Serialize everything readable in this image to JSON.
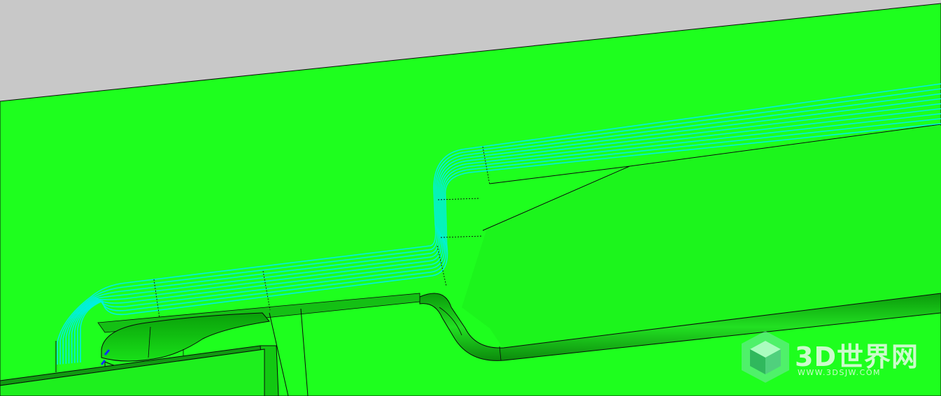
{
  "scene": {
    "background_color": "#c8c8c8",
    "part_face_color": "#1eff1e",
    "part_shadow_color": "#0fd00f",
    "toolpath_color": "#00f0e0",
    "edge_color": "#0a0a0a",
    "marker_color": "#1030ff"
  },
  "watermark": {
    "title": "3D世界网",
    "url": "WWW.3DSJW.COM",
    "logo_icon": "green-cube-logo-icon",
    "color": "#ebfaeb"
  }
}
